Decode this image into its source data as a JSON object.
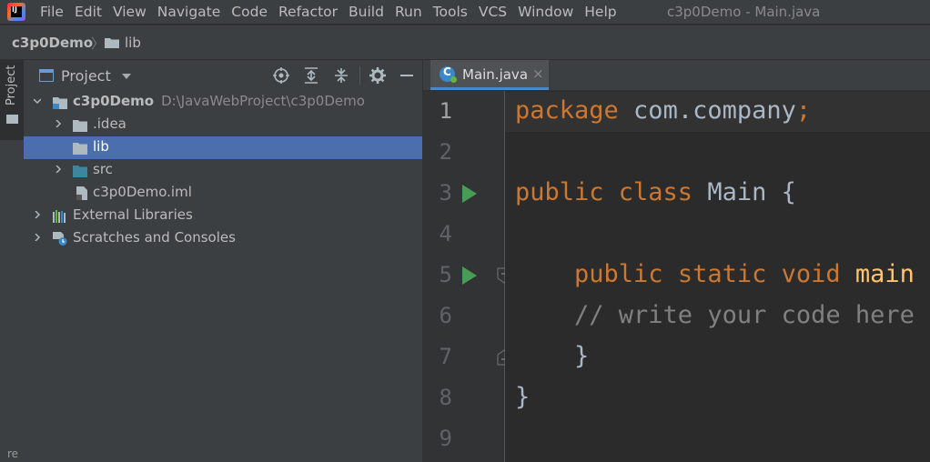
{
  "menubar": {
    "items": [
      "File",
      "Edit",
      "View",
      "Navigate",
      "Code",
      "Refactor",
      "Build",
      "Run",
      "Tools",
      "VCS",
      "Window",
      "Help"
    ],
    "window_title": "c3p0Demo - Main.java"
  },
  "navbar": {
    "project": "c3p0Demo",
    "folder": "lib"
  },
  "toolstrip": {
    "project_label": "Project",
    "bottom_label": "re"
  },
  "project_panel": {
    "title": "Project",
    "tree": [
      {
        "label": "c3p0Demo",
        "path": "D:\\JavaWebProject\\c3p0Demo"
      },
      {
        "label": ".idea"
      },
      {
        "label": "lib"
      },
      {
        "label": "src"
      },
      {
        "label": "c3p0Demo.iml"
      },
      {
        "label": "External Libraries"
      },
      {
        "label": "Scratches and Consoles"
      }
    ],
    "selected": "lib"
  },
  "editor": {
    "tab_label": "Main.java",
    "tab_close": "×",
    "line_numbers": [
      "1",
      "2",
      "3",
      "4",
      "5",
      "6",
      "7",
      "8",
      "9"
    ],
    "code": {
      "l1_kw": "package",
      "l1_rest": " com.company",
      "l1_semi": ";",
      "l3_kw": "public class",
      "l3_rest": " Main {",
      "l5_indent": "    ",
      "l5_kw": "public static void",
      "l5_fn": " main",
      "l6_comment": "    // write your code here",
      "l7_brace": "    }",
      "l8_brace": "}"
    }
  },
  "colors": {
    "keyword": "#cc7832",
    "function": "#ffc66d",
    "comment": "#808080",
    "selection": "#4b6eaf",
    "run_icon": "#499c54"
  }
}
